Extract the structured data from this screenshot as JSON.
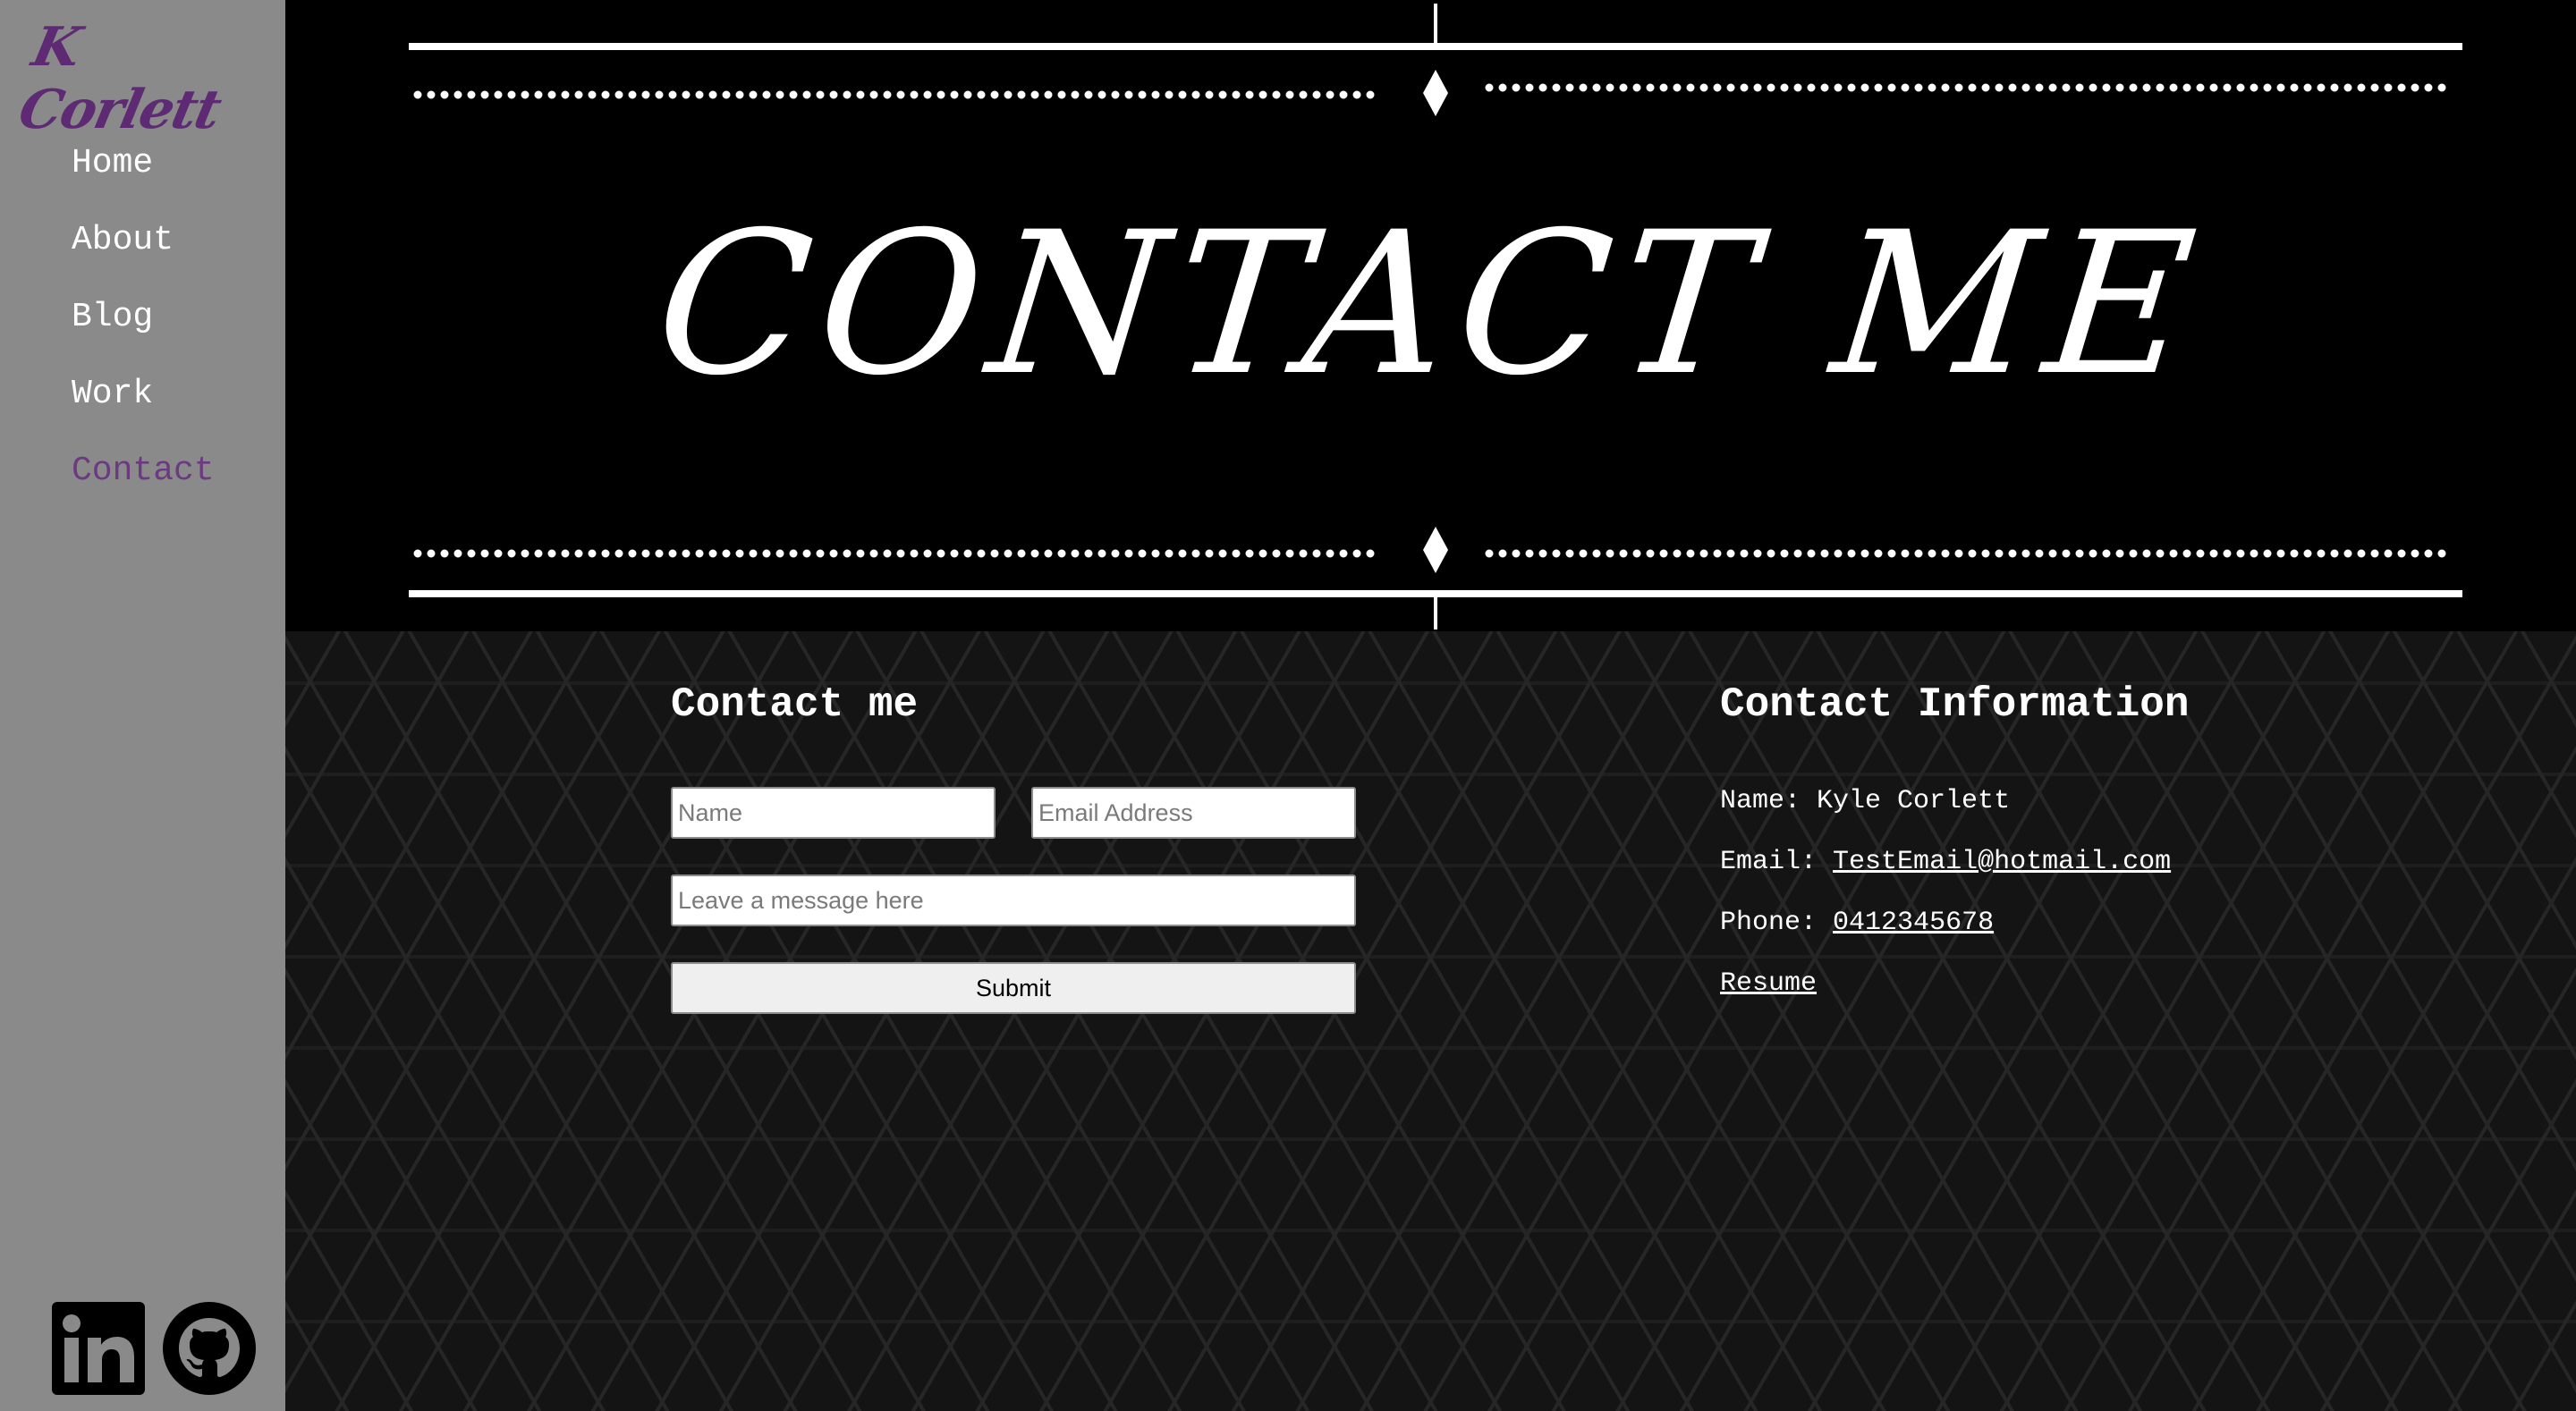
{
  "sidebar": {
    "logo_text": "K Corlett",
    "nav": [
      {
        "label": "Home",
        "active": false
      },
      {
        "label": "About",
        "active": false
      },
      {
        "label": "Blog",
        "active": false
      },
      {
        "label": "Work",
        "active": false
      },
      {
        "label": "Contact",
        "active": true
      }
    ],
    "social_icons": [
      "linkedin-icon",
      "github-icon"
    ]
  },
  "hero": {
    "title": "CONTACT ME"
  },
  "form": {
    "title": "Contact me",
    "name_placeholder": "Name",
    "email_placeholder": "Email Address",
    "message_placeholder": "Leave a message here",
    "submit_label": "Submit"
  },
  "info": {
    "title": "Contact Information",
    "name_label": "Name:",
    "name_value": "Kyle Corlett",
    "email_label": "Email:",
    "email_value": "TestEmail@hotmail.com",
    "phone_label": "Phone:",
    "phone_value": "0412345678",
    "resume_label": "Resume"
  },
  "colors": {
    "sidebar_bg": "#8a8a8a",
    "brand_purple": "#5e2a73",
    "active_nav": "#6b3a80",
    "hero_bg": "#000000"
  }
}
